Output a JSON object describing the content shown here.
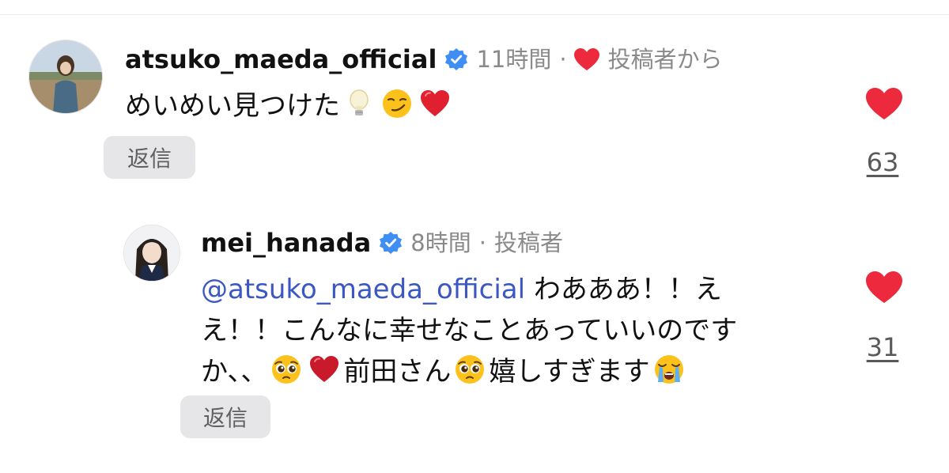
{
  "comments": [
    {
      "username": "atsuko_maeda_official",
      "time": "11時間",
      "separator": "·",
      "badge": "投稿者から",
      "text": "めいめい見つけた",
      "emojis": [
        "light-bulb",
        "smirking-face",
        "red-heart"
      ],
      "reply_label": "返信",
      "like_count": "63"
    }
  ],
  "replies": [
    {
      "username": "mei_hanada",
      "time": "8時間",
      "separator": "·",
      "badge": "投稿者",
      "mention": "@atsuko_maeda_official",
      "line1_rest": " わあああ！！え",
      "line2": "え！！こんなに幸せなことあっていいのです",
      "line3_start": "か、、",
      "line3_mid": "前田さん",
      "line3_end": "嬉しすぎます",
      "reply_label": "返信",
      "like_count": "31"
    }
  ],
  "colors": {
    "heart": "#ed2a3d",
    "verified": "#3f8ef3",
    "mention": "#3b57c4",
    "muted": "#8a8a8a",
    "reply_bg": "#e6e6e8"
  }
}
